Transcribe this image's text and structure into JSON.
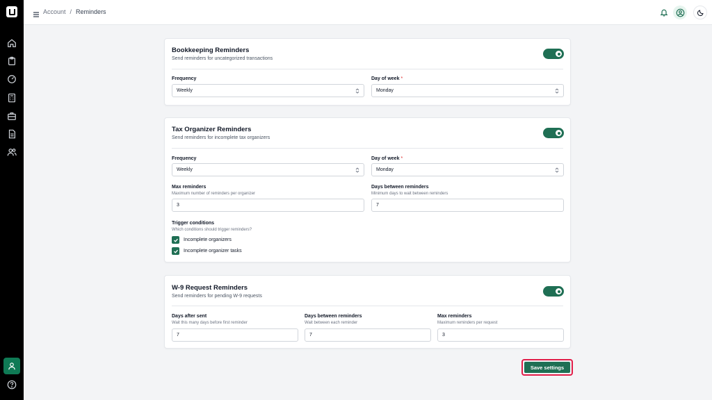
{
  "header": {
    "breadcrumb_root": "Account",
    "breadcrumb_sep": "/",
    "breadcrumb_current": "Reminders"
  },
  "bookkeeping": {
    "title": "Bookkeeping Reminders",
    "description": "Send reminders for uncategorized transactions",
    "enabled": true,
    "frequency_label": "Frequency",
    "frequency_value": "Weekly",
    "day_label": "Day of week",
    "day_required": "*",
    "day_value": "Monday"
  },
  "tax_organizer": {
    "title": "Tax Organizer Reminders",
    "description": "Send reminders for incomplete tax organizers",
    "enabled": true,
    "frequency_label": "Frequency",
    "frequency_value": "Weekly",
    "day_label": "Day of week",
    "day_required": "*",
    "day_value": "Monday",
    "max_label": "Max reminders",
    "max_hint": "Maximum number of reminders per organizer",
    "max_value": "3",
    "between_label": "Days between reminders",
    "between_hint": "Minimum days to wait between reminders",
    "between_value": "7",
    "trigger_label": "Trigger conditions",
    "trigger_hint": "Which conditions should trigger reminders?",
    "triggers": [
      {
        "label": "Incomplete organizers",
        "checked": true
      },
      {
        "label": "Incomplete organizer tasks",
        "checked": true
      }
    ]
  },
  "w9": {
    "title": "W-9 Request Reminders",
    "description": "Send reminders for pending W-9 requests",
    "enabled": true,
    "after_label": "Days after sent",
    "after_hint": "Wait this many days before first reminder",
    "after_value": "7",
    "between_label": "Days between reminders",
    "between_hint": "Wait between each reminder",
    "between_value": "7",
    "max_label": "Max reminders",
    "max_hint": "Maximum reminders per request",
    "max_value": "3"
  },
  "actions": {
    "save_label": "Save settings"
  },
  "colors": {
    "accent": "#1f6f54",
    "highlight": "#e11d48"
  }
}
